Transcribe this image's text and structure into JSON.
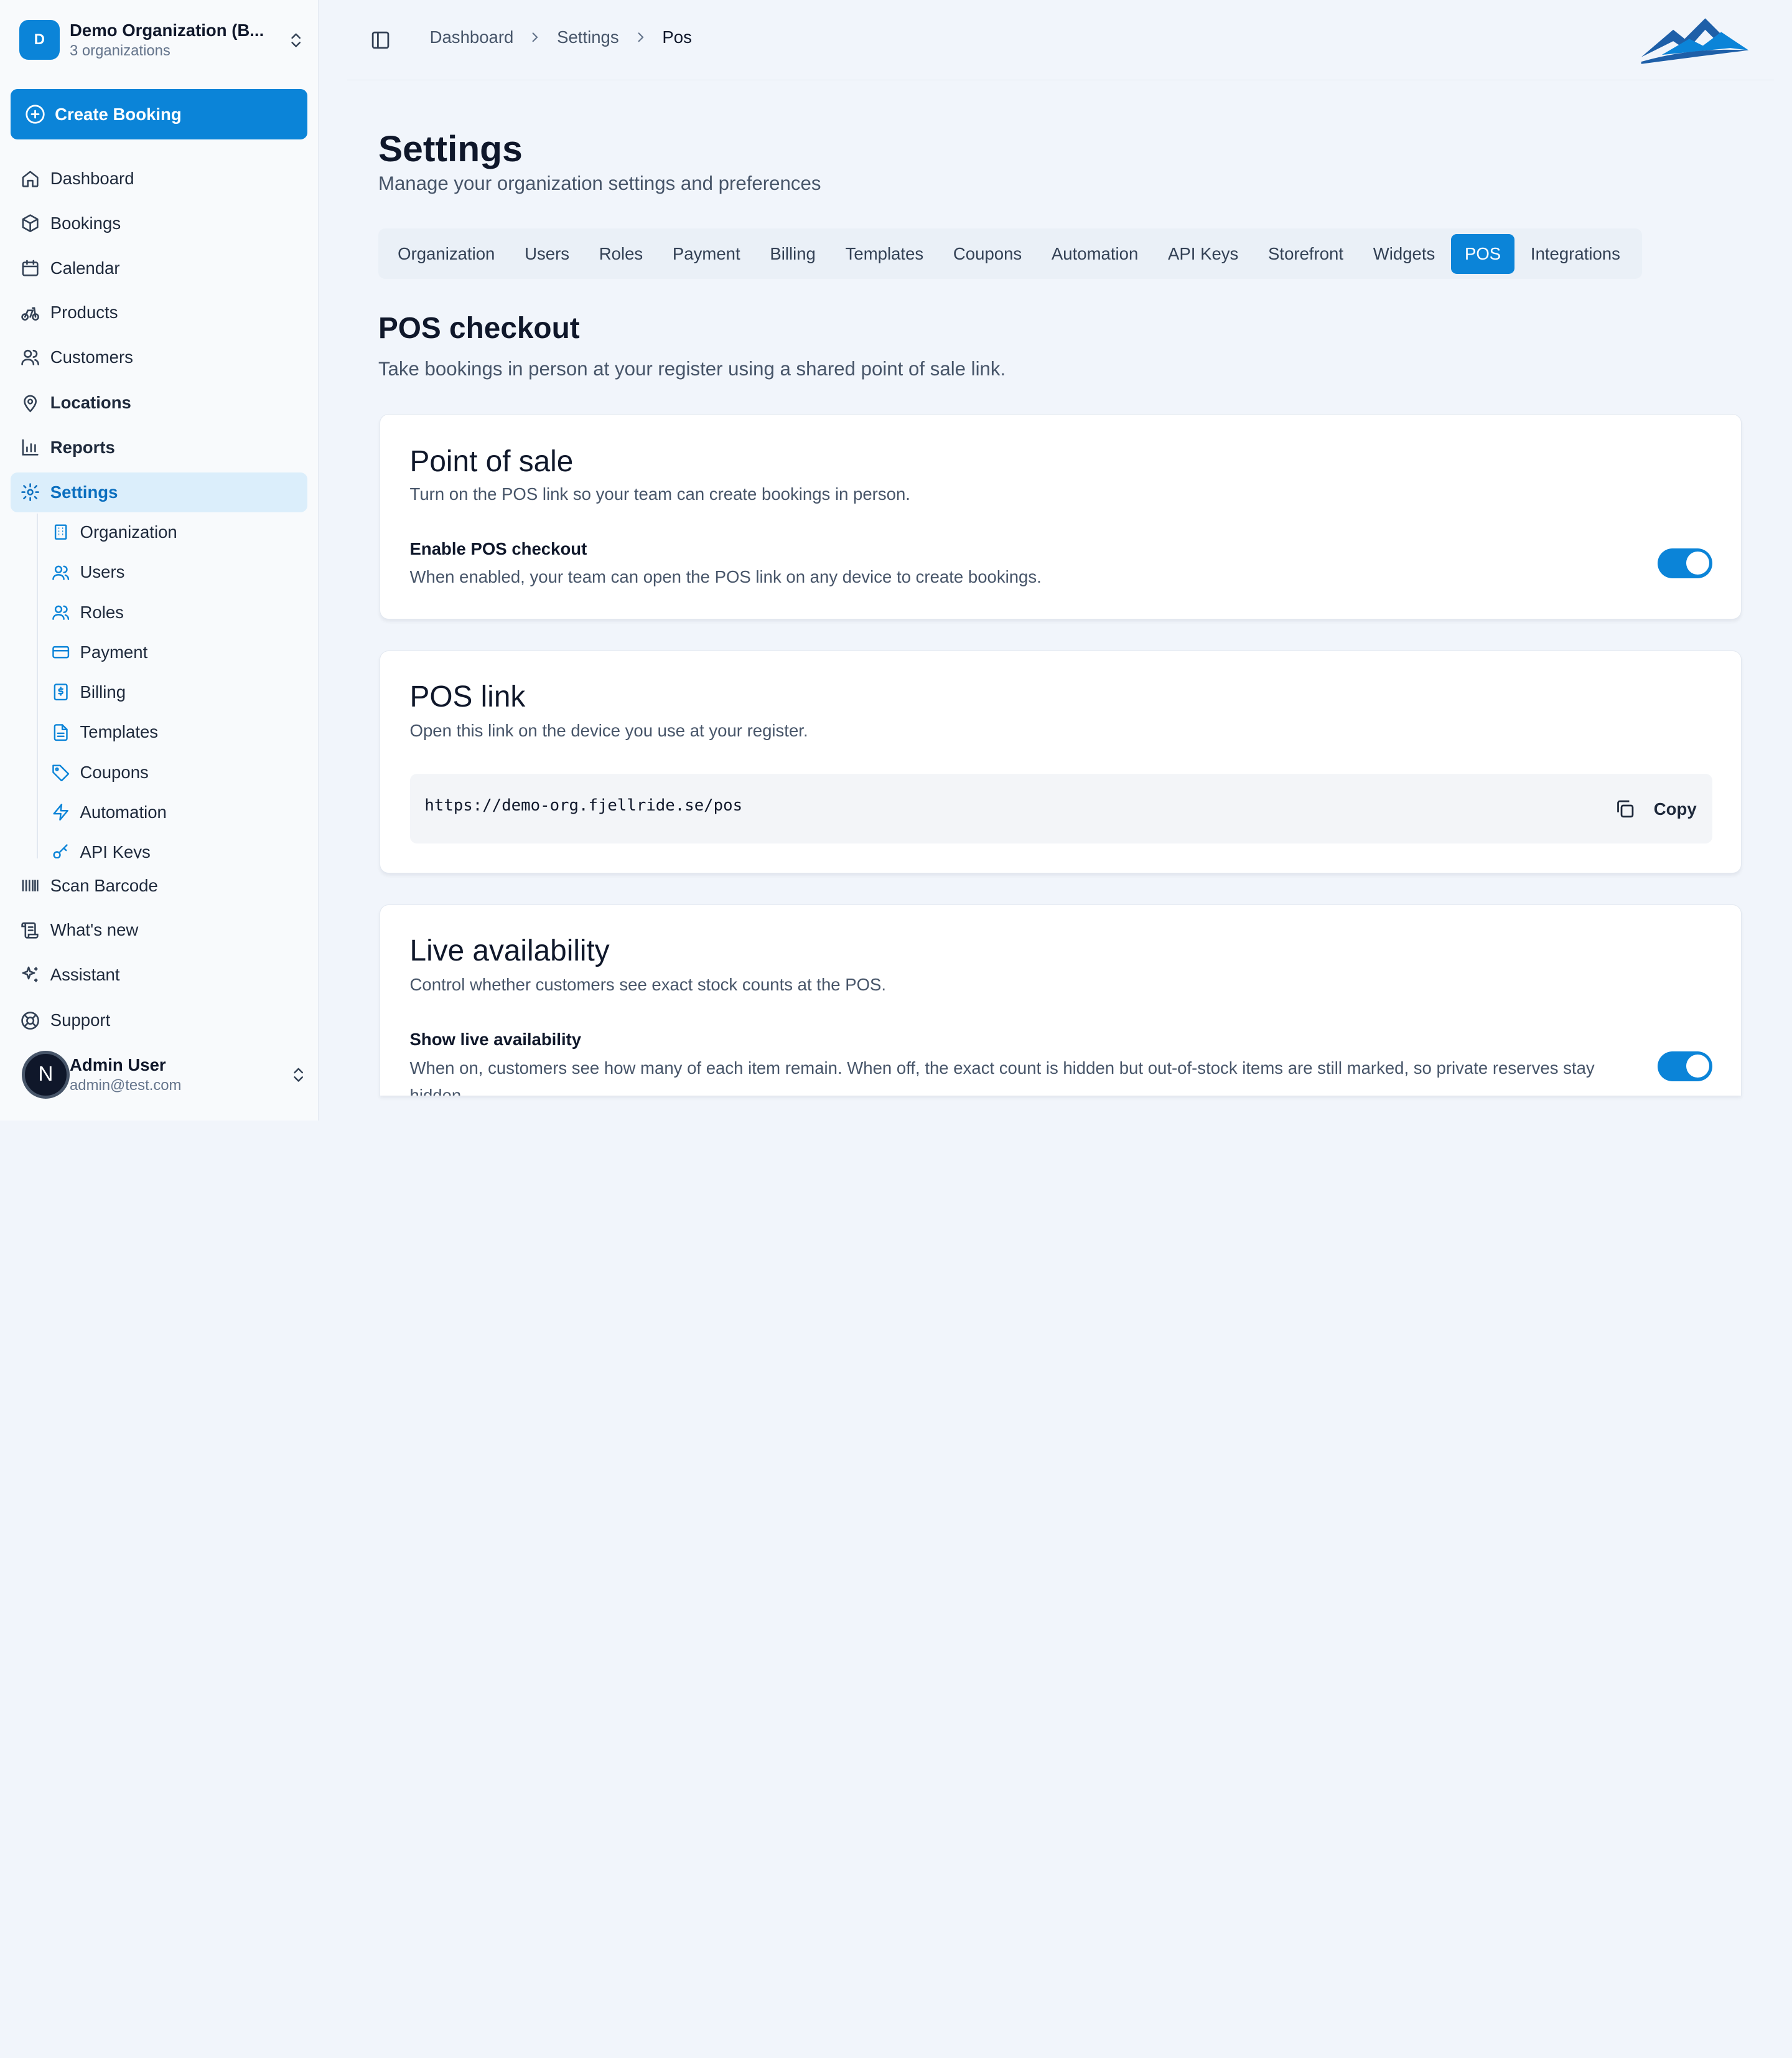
{
  "org": {
    "avatar_letter": "D",
    "name": "Demo Organization (B...",
    "sub": "3 organizations"
  },
  "create_booking_label": "Create Booking",
  "nav": {
    "dashboard": "Dashboard",
    "bookings": "Bookings",
    "calendar": "Calendar",
    "products": "Products",
    "customers": "Customers",
    "locations": "Locations",
    "reports": "Reports",
    "settings": "Settings",
    "scan_barcode": "Scan Barcode",
    "whats_new": "What's new",
    "assistant": "Assistant",
    "support": "Support"
  },
  "settings_subnav": {
    "organization": "Organization",
    "users": "Users",
    "roles": "Roles",
    "payment": "Payment",
    "billing": "Billing",
    "templates": "Templates",
    "coupons": "Coupons",
    "automation": "Automation",
    "api_keys": "API Keys"
  },
  "user": {
    "avatar_letter": "N",
    "name": "Admin User",
    "email": "admin@test.com"
  },
  "breadcrumb": {
    "first": "Dashboard",
    "second": "Settings",
    "current": "Pos"
  },
  "page": {
    "title": "Settings",
    "subtitle": "Manage your organization settings and preferences"
  },
  "tabs": {
    "organization": "Organization",
    "users": "Users",
    "roles": "Roles",
    "payment": "Payment",
    "billing": "Billing",
    "templates": "Templates",
    "coupons": "Coupons",
    "automation": "Automation",
    "api_keys": "API Keys",
    "storefront": "Storefront",
    "widgets": "Widgets",
    "pos": "POS",
    "integrations": "Integrations"
  },
  "pos": {
    "title": "POS checkout",
    "subtitle": "Take bookings in person at your register using a shared point of sale link."
  },
  "point_of_sale": {
    "title": "Point of sale",
    "desc": "Turn on the POS link so your team can create bookings in person.",
    "enable_label": "Enable POS checkout",
    "enable_help": "When enabled, your team can open the POS link on any device to create bookings.",
    "enabled": true
  },
  "pos_link": {
    "title": "POS link",
    "desc": "Open this link on the device you use at your register.",
    "url": "https://demo-org.fjellride.se/pos",
    "copy_label": "Copy"
  },
  "live_availability": {
    "title": "Live availability",
    "desc": "Control whether customers see exact stock counts at the POS.",
    "show_label": "Show live availability",
    "show_help": "When on, customers see how many of each item remain. When off, the exact count is hidden but out-of-stock items are still marked, so private reserves stay hidden.",
    "enabled": true
  },
  "colors": {
    "accent": "#0b84d8",
    "active_bg": "#dbeefb",
    "page_bg": "#f1f5fb"
  }
}
